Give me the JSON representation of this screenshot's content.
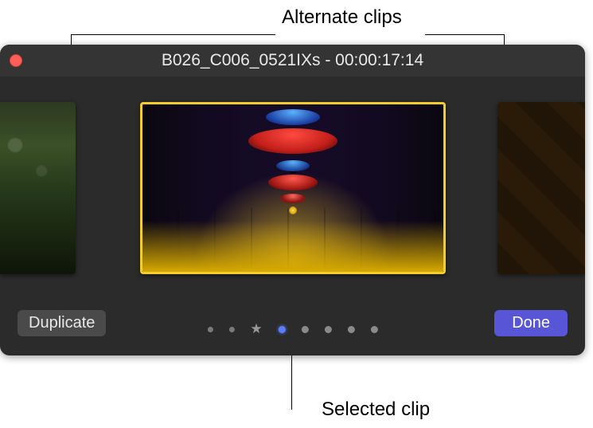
{
  "labels": {
    "alternate_clips": "Alternate clips",
    "selected_clip": "Selected clip"
  },
  "window": {
    "title": "B026_C006_0521IXs - 00:00:17:14"
  },
  "buttons": {
    "duplicate": "Duplicate",
    "done": "Done"
  },
  "pager": {
    "count": 8,
    "favorite_index": 2,
    "active_index": 3
  },
  "colors": {
    "accent": "#5856d6",
    "selection_border": "#f3cc2f"
  }
}
